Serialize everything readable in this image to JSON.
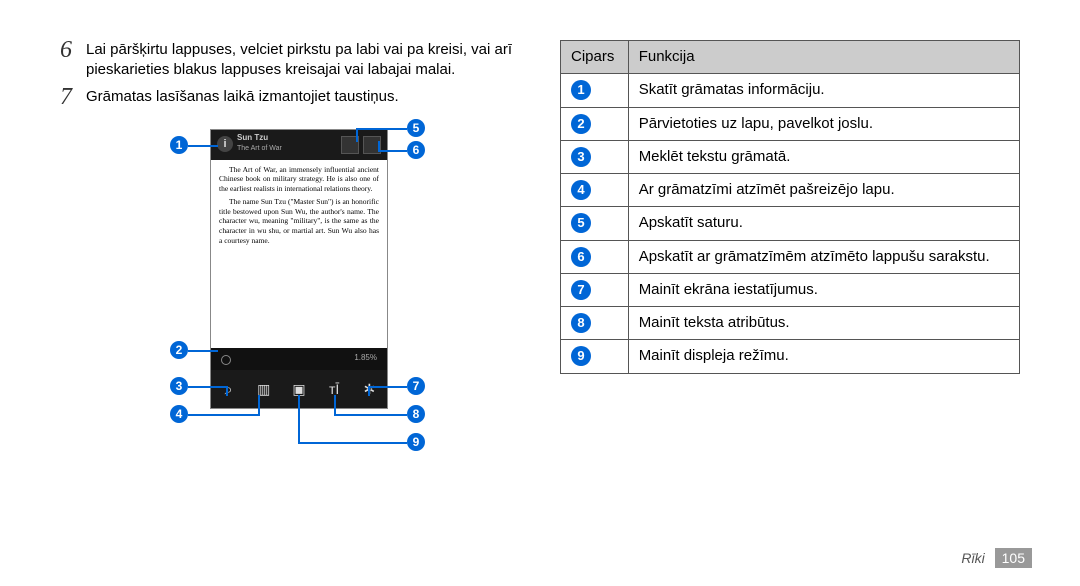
{
  "steps": {
    "s6": {
      "num": "6",
      "text": "Lai pāršķirtu lappuses, velciet pirkstu pa labi vai pa kreisi, vai arī pieskarieties blakus lappuses kreisajai vai labajai malai."
    },
    "s7": {
      "num": "7",
      "text": "Grāmatas lasīšanas laikā izmantojiet taustiņus."
    }
  },
  "phone_sample": {
    "title": "Sun Tzu",
    "subtitle": "The Art of War",
    "info_glyph": "i",
    "para1": "The Art of War, an immensely influential ancient Chinese book on military strategy. He is also one of the earliest realists in international relations theory.",
    "para2": "The name Sun Tzu (\"Master Sun\") is an honorific title bestowed upon Sun Wu, the author's name. The character wu, meaning \"military\", is the same as the character in wu shu, or martial art. Sun Wu also has a courtesy name.",
    "progress": "1.85%",
    "icons": {
      "search": "⌕",
      "toc": "▥",
      "bookmark": "▣",
      "font": "тĪ",
      "settings": "✲"
    }
  },
  "callouts": {
    "c1": "1",
    "c2": "2",
    "c3": "3",
    "c4": "4",
    "c5": "5",
    "c6": "6",
    "c7": "7",
    "c8": "8",
    "c9": "9"
  },
  "table": {
    "head": {
      "col1": "Cipars",
      "col2": "Funkcija"
    },
    "rows": [
      {
        "n": "1",
        "f": "Skatīt grāmatas informāciju."
      },
      {
        "n": "2",
        "f": "Pārvietoties uz lapu, pavelkot joslu."
      },
      {
        "n": "3",
        "f": "Meklēt tekstu grāmatā."
      },
      {
        "n": "4",
        "f": "Ar grāmatzīmi atzīmēt pašreizējo lapu."
      },
      {
        "n": "5",
        "f": "Apskatīt saturu."
      },
      {
        "n": "6",
        "f": "Apskatīt ar grāmatzīmēm atzīmēto lappušu sarakstu."
      },
      {
        "n": "7",
        "f": "Mainīt ekrāna iestatījumus."
      },
      {
        "n": "8",
        "f": "Mainīt teksta atribūtus."
      },
      {
        "n": "9",
        "f": "Mainīt displeja režīmu."
      }
    ]
  },
  "footer": {
    "section": "Rīki",
    "page": "105"
  }
}
